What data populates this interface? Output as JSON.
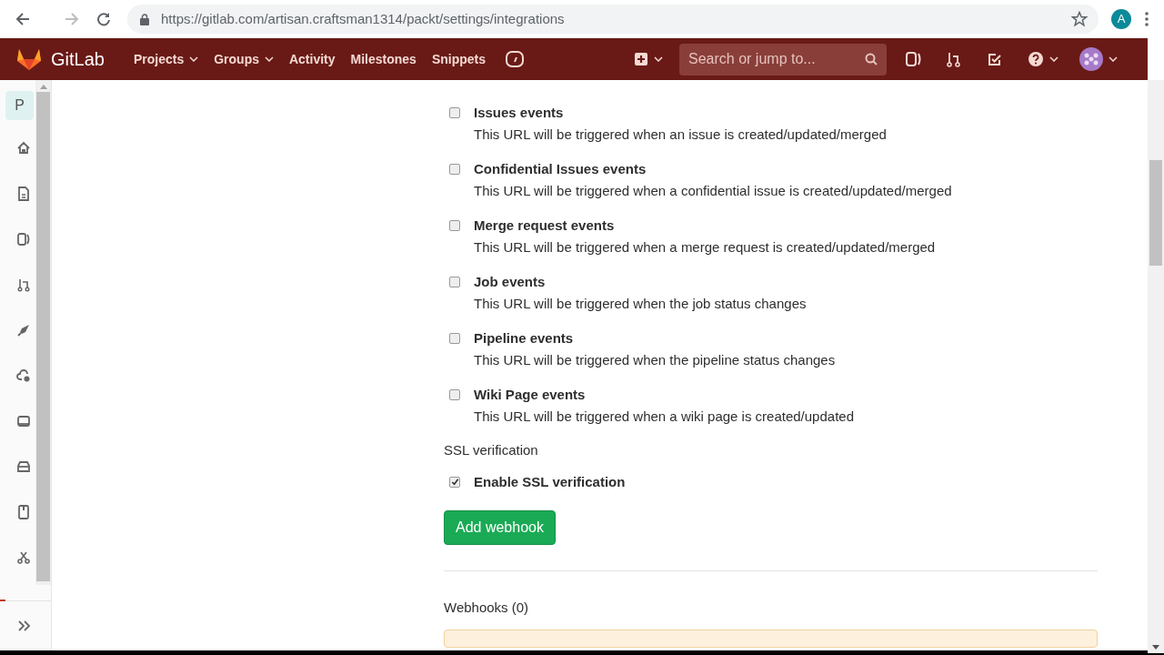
{
  "browser": {
    "url": "https://gitlab.com/artisan.craftsman1314/packt/settings/integrations",
    "profile_letter": "A"
  },
  "navbar": {
    "logo": "GitLab",
    "links": [
      {
        "label": "Projects",
        "dropdown": true
      },
      {
        "label": "Groups",
        "dropdown": true
      },
      {
        "label": "Activity",
        "dropdown": false
      },
      {
        "label": "Milestones",
        "dropdown": false
      },
      {
        "label": "Snippets",
        "dropdown": false
      }
    ],
    "search": {
      "placeholder": "Search or jump to..."
    }
  },
  "sidebar": {
    "project_letter": "P",
    "project_selected": true
  },
  "events": [
    {
      "title": "Issues events",
      "description": "This URL will be triggered when an issue is created/updated/merged",
      "checked": false
    },
    {
      "title": "Confidential Issues events",
      "description": "This URL will be triggered when a confidential issue is created/updated/merged",
      "checked": false
    },
    {
      "title": "Merge request events",
      "description": "This URL will be triggered when a merge request is created/updated/merged",
      "checked": false
    },
    {
      "title": "Job events",
      "description": "This URL will be triggered when the job status changes",
      "checked": false
    },
    {
      "title": "Pipeline events",
      "description": "This URL will be triggered when the pipeline status changes",
      "checked": false
    },
    {
      "title": "Wiki Page events",
      "description": "This URL will be triggered when a wiki page is created/updated",
      "checked": false
    }
  ],
  "ssl": {
    "heading": "SSL verification",
    "label": "Enable SSL verification",
    "checked": true
  },
  "add_button": "Add webhook",
  "webhooks_heading": "Webhooks (0)"
}
